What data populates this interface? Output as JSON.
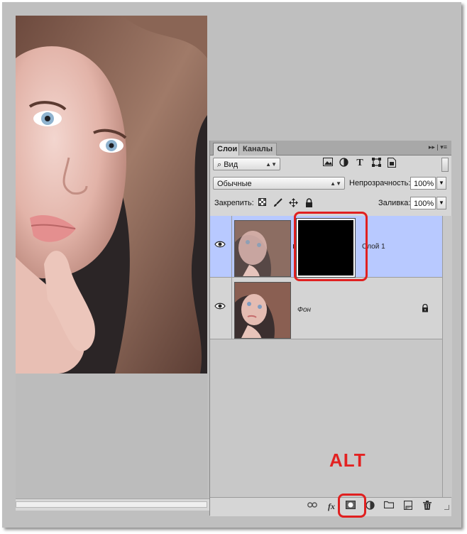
{
  "panel": {
    "tabs": [
      {
        "label": "Слои",
        "active": true
      },
      {
        "label": "Каналы",
        "active": false
      }
    ],
    "topbar_icons": "▸▸ | ▾≡",
    "filter": {
      "value": "Вид",
      "icon": "search-icon"
    },
    "filter_icons": [
      "image-filter-icon",
      "adjustment-filter-icon",
      "type-filter-icon",
      "shape-filter-icon",
      "smart-object-filter-icon"
    ],
    "blend_mode": {
      "value": "Обычные"
    },
    "opacity": {
      "label": "Непрозрачность:",
      "value": "100%"
    },
    "lock": {
      "label": "Закрепить:",
      "icons": [
        "lock-transparent-icon",
        "lock-paint-icon",
        "lock-position-icon",
        "lock-all-icon"
      ]
    },
    "fill": {
      "label": "Заливка:",
      "value": "100%"
    },
    "layers": [
      {
        "name": "Слой 1",
        "visible": true,
        "selected": true,
        "has_mask": true,
        "locked": false
      },
      {
        "name": "Фон",
        "visible": true,
        "selected": false,
        "has_mask": false,
        "locked": true
      }
    ],
    "bottom_icons": [
      "link-icon",
      "fx-icon",
      "add-mask-icon",
      "adjustment-layer-icon",
      "group-folder-icon",
      "new-layer-icon",
      "delete-icon"
    ],
    "fx_label": "fx"
  },
  "annotation": {
    "alt_label": "ALT",
    "color": "#e32222"
  },
  "colors": {
    "selected_layer": "#b8c9ff",
    "panel_bg": "#d6d6d6",
    "workspace": "#bfbfbf"
  }
}
